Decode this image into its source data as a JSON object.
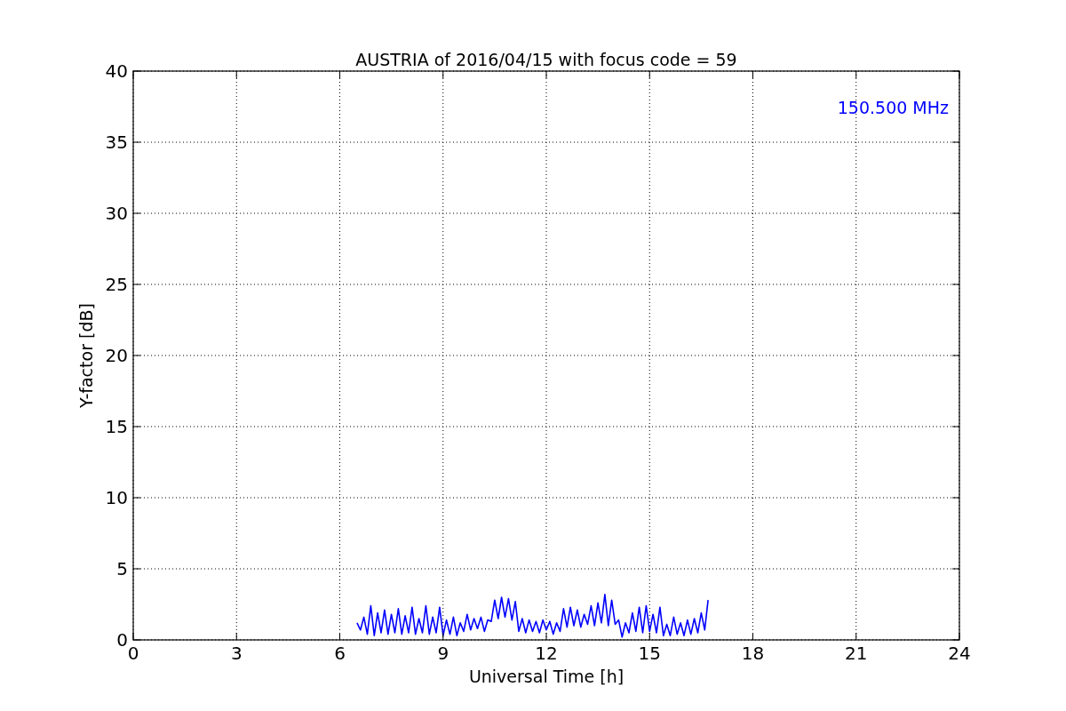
{
  "figure": {
    "chart_data": {
      "type": "line",
      "title": "AUSTRIA of 2016/04/15 with focus code = 59",
      "xlabel": "Universal Time [h]",
      "ylabel": "Y-factor [dB]",
      "xlim": [
        0,
        24
      ],
      "ylim": [
        0,
        40
      ],
      "grid": true,
      "xticks": [
        0,
        3,
        6,
        9,
        12,
        15,
        18,
        21,
        24
      ],
      "yticks": [
        0,
        5,
        10,
        15,
        20,
        25,
        30,
        35,
        40
      ],
      "x": [
        6.5,
        6.6,
        6.7,
        6.8,
        6.9,
        7.0,
        7.1,
        7.2,
        7.3,
        7.4,
        7.5,
        7.6,
        7.7,
        7.8,
        7.9,
        8.0,
        8.1,
        8.2,
        8.3,
        8.4,
        8.5,
        8.6,
        8.7,
        8.8,
        8.9,
        9.0,
        9.1,
        9.2,
        9.3,
        9.4,
        9.5,
        9.6,
        9.7,
        9.8,
        9.9,
        10.0,
        10.1,
        10.2,
        10.3,
        10.4,
        10.5,
        10.6,
        10.7,
        10.8,
        10.9,
        11.0,
        11.1,
        11.2,
        11.3,
        11.4,
        11.5,
        11.6,
        11.7,
        11.8,
        11.9,
        12.0,
        12.1,
        12.2,
        12.3,
        12.4,
        12.5,
        12.6,
        12.7,
        12.8,
        12.9,
        13.0,
        13.1,
        13.2,
        13.3,
        13.4,
        13.5,
        13.6,
        13.7,
        13.8,
        13.9,
        14.0,
        14.1,
        14.2,
        14.3,
        14.4,
        14.5,
        14.6,
        14.7,
        14.8,
        14.9,
        15.0,
        15.1,
        15.2,
        15.3,
        15.4,
        15.5,
        15.6,
        15.7,
        15.8,
        15.9,
        16.0,
        16.1,
        16.2,
        16.3,
        16.4,
        16.5,
        16.6,
        16.7
      ],
      "series": [
        {
          "name": "150.500 MHz",
          "color": "#0000ff",
          "values": [
            1.2,
            0.7,
            1.6,
            0.4,
            2.4,
            0.3,
            1.9,
            0.5,
            2.1,
            0.4,
            1.8,
            0.5,
            2.2,
            0.4,
            1.7,
            0.5,
            2.3,
            0.4,
            1.5,
            0.5,
            2.4,
            0.4,
            1.6,
            0.5,
            2.3,
            0.3,
            1.4,
            0.4,
            1.6,
            0.3,
            1.2,
            0.6,
            1.8,
            0.7,
            1.5,
            0.8,
            1.6,
            0.6,
            1.4,
            1.3,
            2.8,
            1.5,
            3.0,
            1.6,
            2.9,
            1.4,
            2.7,
            0.6,
            1.5,
            0.5,
            1.4,
            0.6,
            1.3,
            0.5,
            1.4,
            0.7,
            1.3,
            0.4,
            1.2,
            0.6,
            2.2,
            0.9,
            2.3,
            1.0,
            2.1,
            0.9,
            1.8,
            1.1,
            2.4,
            1.0,
            2.6,
            1.2,
            3.2,
            1.0,
            2.8,
            1.1,
            1.4,
            0.2,
            1.2,
            0.5,
            1.9,
            0.6,
            2.3,
            0.5,
            2.4,
            0.6,
            1.8,
            0.5,
            2.3,
            0.3,
            1.1,
            0.3,
            1.6,
            0.4,
            1.2,
            0.3,
            1.4,
            0.4,
            1.5,
            0.5,
            1.9,
            0.7,
            2.8
          ]
        }
      ]
    }
  }
}
